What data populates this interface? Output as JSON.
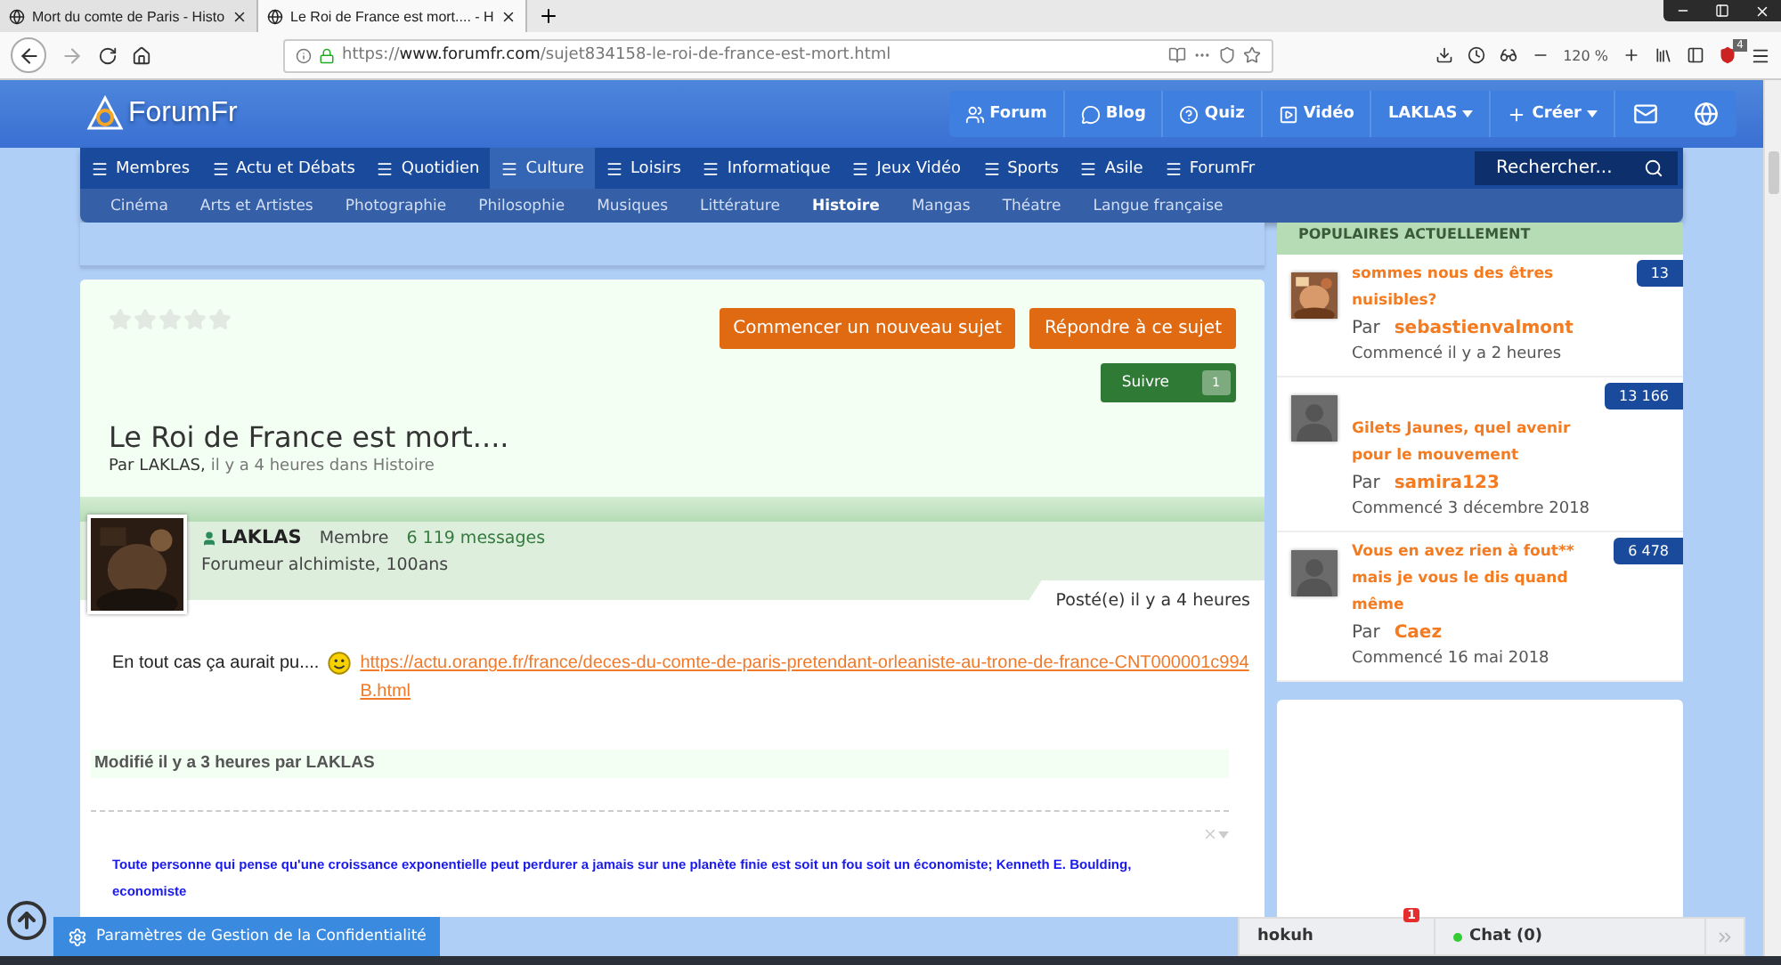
{
  "browser": {
    "tabs": [
      {
        "title": "Mort du comte de Paris - Histo",
        "selected": false
      },
      {
        "title": "Le Roi de France est mort.... - H",
        "selected": true
      }
    ],
    "url_host": "www.forumfr.com",
    "url_scheme": "https://",
    "url_path": "/sujet834158-le-roi-de-france-est-mort.html",
    "zoom": "120 %",
    "extension_badge": "4"
  },
  "header": {
    "logo": "ForumFr",
    "links": [
      {
        "label": "Forum",
        "dropdown": false
      },
      {
        "label": "Blog",
        "dropdown": false
      },
      {
        "label": "Quiz",
        "dropdown": false
      },
      {
        "label": "Vidéo",
        "dropdown": false
      },
      {
        "label": "LAKLAS",
        "dropdown": true
      },
      {
        "label": "Créer",
        "dropdown": true
      }
    ]
  },
  "main_nav": [
    {
      "label": "Membres",
      "selected": false
    },
    {
      "label": "Actu et Débats",
      "selected": false
    },
    {
      "label": "Quotidien",
      "selected": false
    },
    {
      "label": "Culture",
      "selected": true
    },
    {
      "label": "Loisirs",
      "selected": false
    },
    {
      "label": "Informatique",
      "selected": false
    },
    {
      "label": "Jeux Vidéo",
      "selected": false
    },
    {
      "label": "Sports",
      "selected": false
    },
    {
      "label": "Asile",
      "selected": false
    },
    {
      "label": "ForumFr",
      "selected": false
    }
  ],
  "search": {
    "placeholder": "Rechercher..."
  },
  "sub_nav": [
    {
      "label": "Cinéma",
      "selected": false
    },
    {
      "label": "Arts et Artistes",
      "selected": false
    },
    {
      "label": "Photographie",
      "selected": false
    },
    {
      "label": "Philosophie",
      "selected": false
    },
    {
      "label": "Musiques",
      "selected": false
    },
    {
      "label": "Littérature",
      "selected": false
    },
    {
      "label": "Histoire",
      "selected": true
    },
    {
      "label": "Mangas",
      "selected": false
    },
    {
      "label": "Théatre",
      "selected": false
    },
    {
      "label": "Langue française",
      "selected": false
    }
  ],
  "topic": {
    "stars": 0,
    "buttons": [
      "Commencer un nouveau sujet",
      "Répondre à ce sujet"
    ],
    "follow": {
      "label": "Suivre",
      "count": "1"
    },
    "title": "Le Roi de France est mort....",
    "author": "Par LAKLAS,",
    "meta": "il y a 4 heures dans Histoire"
  },
  "post": {
    "author": "LAKLAS",
    "role": "Membre",
    "messages": "6 119 messages",
    "tagline": "Forumeur alchimiste, 100ans",
    "posted": "Posté(e) il y a 4 heures",
    "text": "En tout cas ça aurait pu....",
    "link": "https://actu.orange.fr/france/deces-du-comte-de-paris-pretendant-orleaniste-au-trone-de-france-CNT000001c994B.html",
    "edited": "Modifié il y a 3 heures par LAKLAS",
    "signature": "Toute personne qui pense qu'une croissance exponentielle peut perdurer a jamais sur une planète finie est soit un fou soit un économiste; Kenneth E. Boulding, economiste"
  },
  "sidebar": {
    "title": "POPULAIRES ACTUELLEMENT",
    "items": [
      {
        "title": "sommes nous des êtres nuisibles?",
        "by": "Par",
        "author": "sebastienvalmont",
        "started": "Commencé il y a 2 heures",
        "count": "13"
      },
      {
        "title": "Gilets Jaunes, quel avenir pour le mouvement",
        "by": "Par",
        "author": "samira123",
        "started": "Commencé 3 décembre 2018",
        "count": "13 166",
        "kind": "default"
      },
      {
        "title": "Vous en avez rien à fout** mais je vous le dis quand même",
        "by": "Par",
        "author": "Caez",
        "started": "Commencé 16 mai 2018",
        "count": "6 478",
        "kind": "default"
      }
    ]
  },
  "footer": {
    "privacy": "Paramètres de Gestion de la Confidentialité",
    "chat_user": "hokuh",
    "notifications": "1",
    "chat": "Chat (0)",
    "online": true
  }
}
